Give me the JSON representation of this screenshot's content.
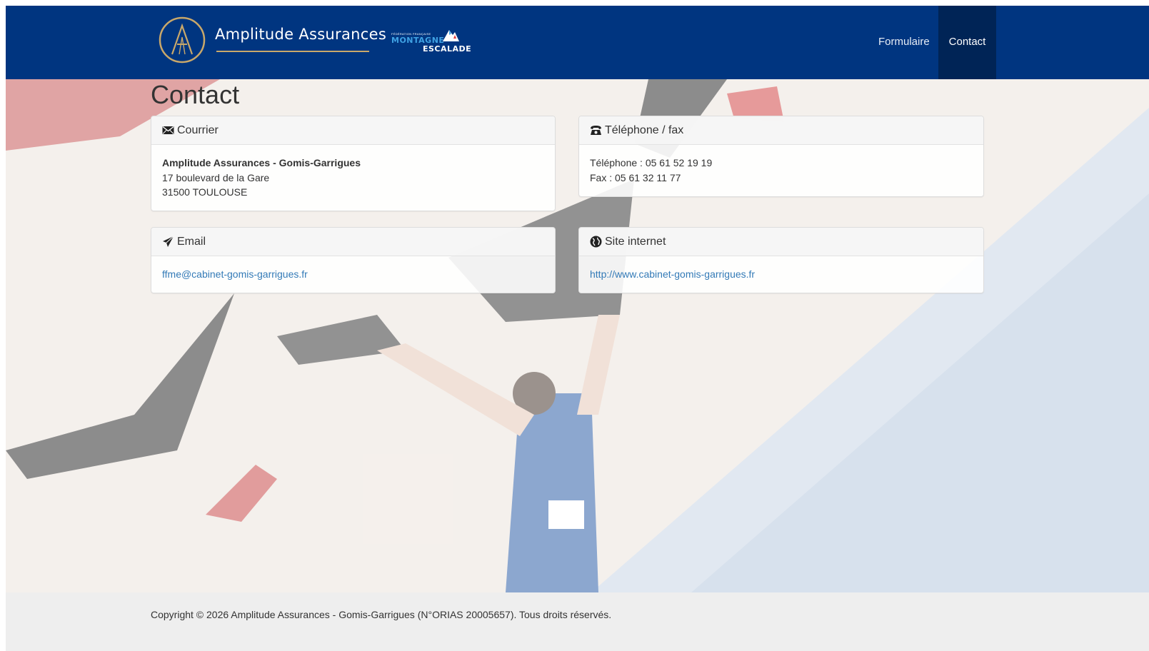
{
  "header": {
    "brand_name": "Amplitude Assurances",
    "partner_logo": {
      "small": "FÉDÉRATION FRANÇAISE",
      "line1": "MONTAGNE",
      "line2": "ESCALADE"
    },
    "nav": [
      {
        "label": "Formulaire",
        "active": false
      },
      {
        "label": "Contact",
        "active": true
      }
    ]
  },
  "main": {
    "title": "Contact",
    "panels": {
      "courrier": {
        "icon": "envelope-icon",
        "heading": "Courrier",
        "name": "Amplitude Assurances - Gomis-Garrigues",
        "street": "17 boulevard de la Gare",
        "city": "31500 TOULOUSE"
      },
      "telephone": {
        "icon": "phone-icon",
        "heading": "Téléphone / fax",
        "phone": "Téléphone : 05 61 52 19 19",
        "fax": "Fax : 05 61 32 11 77"
      },
      "email": {
        "icon": "send-icon",
        "heading": "Email",
        "address": "ffme@cabinet-gomis-garrigues.fr"
      },
      "site": {
        "icon": "globe-icon",
        "heading": "Site internet",
        "url": "http://www.cabinet-gomis-garrigues.fr"
      }
    }
  },
  "footer": {
    "copyright": "Copyright © 2026 Amplitude Assurances - Gomis-Garrigues (N°ORIAS 20005657). Tous droits réservés."
  },
  "colors": {
    "navbar": "#003580",
    "nav_active": "#002456",
    "link": "#337ab7",
    "gold": "#c9a86a",
    "footer": "#eeeeee"
  }
}
